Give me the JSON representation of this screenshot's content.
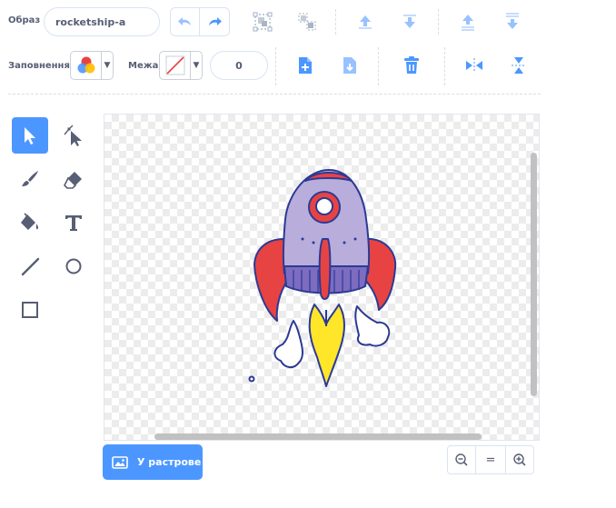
{
  "costume": {
    "label": "Образ",
    "name": "rocketship-a"
  },
  "fill": {
    "label": "Заповнення"
  },
  "outline": {
    "label": "Межа",
    "width": "0"
  },
  "bitmap_button": {
    "label": "У растрове"
  },
  "zoom": {
    "reset_label": "="
  },
  "colors": {
    "accent": "#4c97ff",
    "text": "#575e75",
    "rocket_body": "#b8addb",
    "rocket_red": "#e84343",
    "flame": "#ffe629",
    "outline": "#2c3a94"
  },
  "icons": {
    "toolbar": [
      "undo-icon",
      "redo-icon",
      "group-icon",
      "ungroup-icon",
      "forward-icon",
      "backward-icon",
      "front-icon",
      "back-icon",
      "copy-icon",
      "paste-icon",
      "delete-icon",
      "flip-horizontal-icon",
      "flip-vertical-icon"
    ],
    "tools": [
      "select-icon",
      "reshape-icon",
      "brush-icon",
      "eraser-icon",
      "fill-icon",
      "text-icon",
      "line-icon",
      "circle-icon",
      "rectangle-icon"
    ]
  }
}
